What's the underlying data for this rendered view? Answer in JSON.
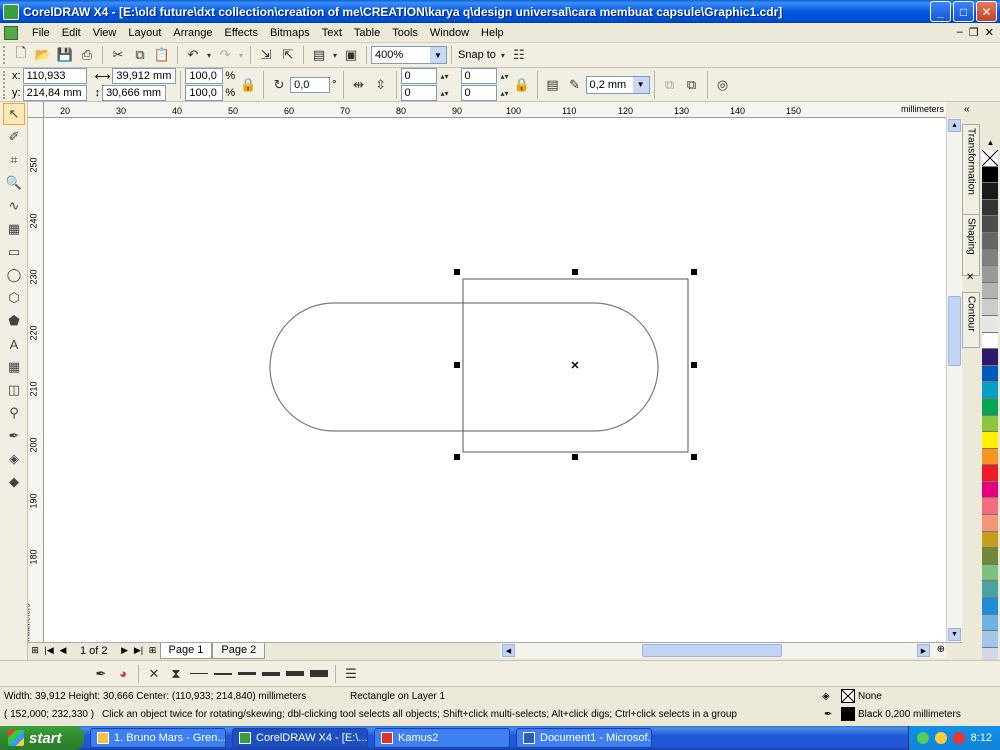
{
  "window": {
    "title": "CorelDRAW X4 - [E:\\old future\\dxt collection\\creation of me\\CREATION\\karya q\\design universal\\cara membuat capsule\\Graphic1.cdr]",
    "minimize": "_",
    "maximize": "□",
    "close": "✕"
  },
  "menu": [
    "File",
    "Edit",
    "View",
    "Layout",
    "Arrange",
    "Effects",
    "Bitmaps",
    "Text",
    "Table",
    "Tools",
    "Window",
    "Help"
  ],
  "standard_toolbar": {
    "zoom_value": "400%",
    "snap_to_label": "Snap to"
  },
  "property_bar": {
    "x_label": "x:",
    "x_value": "110,933 mm",
    "y_label": "y:",
    "y_value": "214,84 mm",
    "width_value": "39,912 mm",
    "height_value": "30,666 mm",
    "scale_x": "100,0",
    "scale_y": "100,0",
    "percent": "%",
    "rotation": "0,0",
    "degree": "°",
    "corner_tl": "0",
    "corner_bl": "0",
    "corner_tr": "0",
    "corner_br": "0",
    "outline_width": "0,2 mm"
  },
  "rulers": {
    "units": "millimeters",
    "top_ticks": [
      "20",
      "30",
      "40",
      "50",
      "60",
      "70",
      "80",
      "90",
      "100",
      "110",
      "120",
      "130",
      "140",
      "150"
    ],
    "left_ticks": [
      "250",
      "240",
      "230",
      "220",
      "210",
      "200",
      "190",
      "180"
    ],
    "left_units": "millimeters"
  },
  "dockers": {
    "transformation": "Transformation",
    "shaping": "Shaping",
    "contour": "Contour"
  },
  "palette": [
    "#ffffff",
    "#000000",
    "#1a1a1a",
    "#333333",
    "#4d4d4d",
    "#666666",
    "#808080",
    "#999999",
    "#b3b3b3",
    "#cccccc",
    "#e6e6e6",
    "#ffffff",
    "#2e1a6b",
    "#005bbb",
    "#00a0c6",
    "#00a651",
    "#8cc63f",
    "#fff200",
    "#f7941d",
    "#ed1c24",
    "#e4007c",
    "#f26d7d",
    "#f69679",
    "#c4a01a",
    "#6c8a3a",
    "#7fbf7f",
    "#4aa3a3",
    "#1e8fd6",
    "#6fb1e3",
    "#a2c6e8",
    "#d0d8e8"
  ],
  "pages": {
    "counter": "1 of 2",
    "tabs": [
      "Page 1",
      "Page 2"
    ]
  },
  "status": {
    "dimensions": "Width: 39,912  Height: 30,666  Center: (110,933; 214,840)  millimeters",
    "object_info": "Rectangle on Layer 1",
    "cursor_pos": "( 152,000; 232,330 )",
    "hint": "Click an object twice for rotating/skewing; dbl-clicking tool selects all objects; Shift+click multi-selects; Alt+click digs; Ctrl+click selects in a group",
    "fill_label": "None",
    "outline_label": "Black  0,200 millimeters"
  },
  "taskbar": {
    "start": "start",
    "tasks": [
      "1. Bruno Mars - Gren...",
      "CorelDRAW X4 - [E:\\...",
      "Kamus2",
      "Document1 - Microsof..."
    ],
    "clock": "8:12"
  }
}
